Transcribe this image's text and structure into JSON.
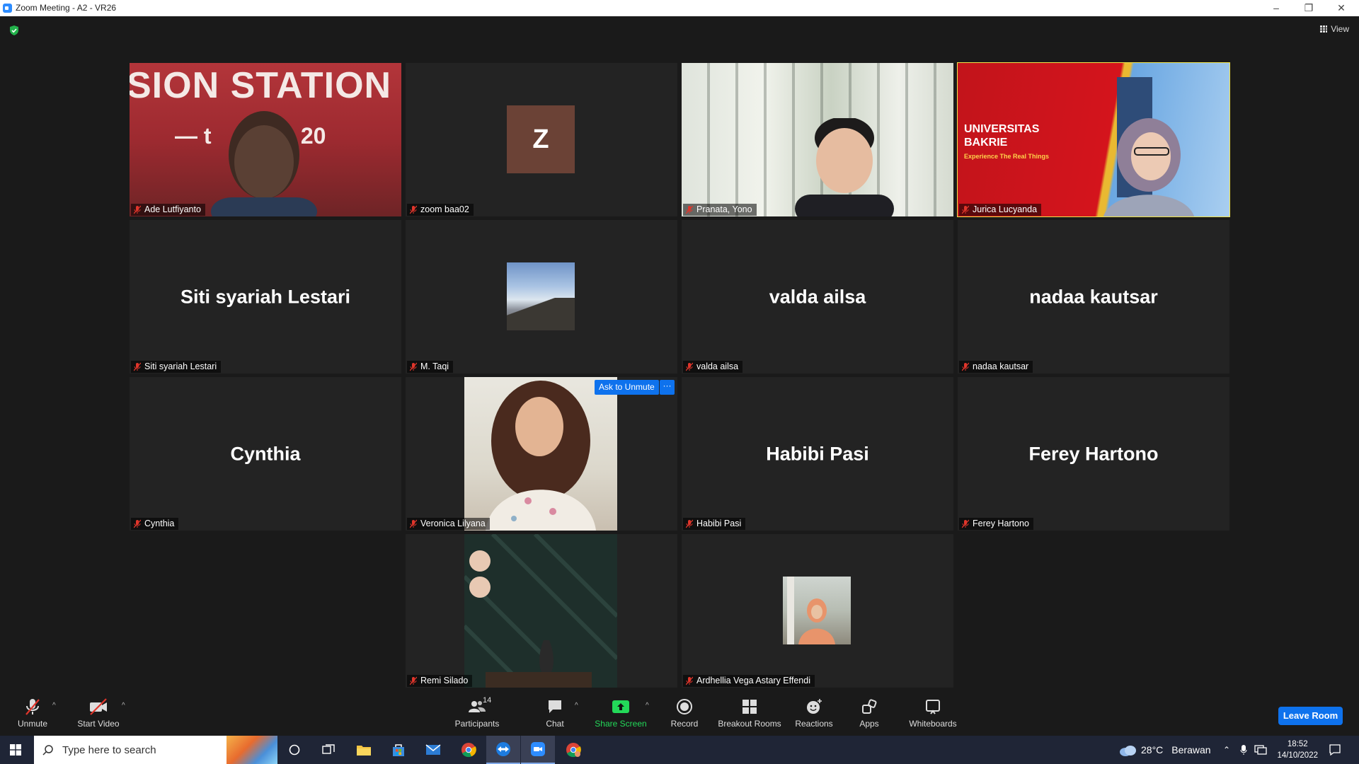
{
  "window": {
    "title": "Zoom Meeting - A2 - VR26",
    "view_label": "View"
  },
  "participants": [
    {
      "name": "Ade Lutfiyanto",
      "display": "video",
      "muted": true
    },
    {
      "name": "zoom baa02",
      "display": "avatar-letter",
      "avatar_letter": "Z",
      "avatar_color": "#6b4236",
      "muted": true
    },
    {
      "name": "Pranata, Yono",
      "display": "video",
      "muted": true
    },
    {
      "name": "Jurica Lucyanda",
      "display": "video",
      "muted": true,
      "active_speaker": true
    },
    {
      "name": "Siti syariah Lestari",
      "display": "name",
      "muted": true
    },
    {
      "name": "M. Taqi",
      "display": "photo",
      "muted": true
    },
    {
      "name": "valda ailsa",
      "display": "name",
      "muted": true
    },
    {
      "name": "nadaa kautsar",
      "display": "name",
      "muted": true
    },
    {
      "name": "Cynthia",
      "display": "name",
      "muted": true
    },
    {
      "name": "Veronica Lilyana",
      "display": "video",
      "muted": true
    },
    {
      "name": "Habibi Pasi",
      "display": "name",
      "muted": true
    },
    {
      "name": "Ferey Hartono",
      "display": "name",
      "muted": true
    },
    {
      "name": "Remi Silado",
      "display": "video",
      "muted": true
    },
    {
      "name": "Ardhellia Vega Astary Effendi",
      "display": "photo",
      "muted": true
    }
  ],
  "video_overlays": {
    "ade_banner": "SION STATION",
    "ade_banner2": "— t    since 20",
    "jurica_title": "UNIVERSITAS BAKRIE",
    "jurica_sub": "Experience The Real Things"
  },
  "hover_controls": {
    "ask_to_unmute": "Ask to Unmute",
    "more": "···"
  },
  "toolbar": {
    "unmute": "Unmute",
    "start_video": "Start Video",
    "participants": "Participants",
    "participants_count": "14",
    "chat": "Chat",
    "share_screen": "Share Screen",
    "record": "Record",
    "breakout_rooms": "Breakout Rooms",
    "reactions": "Reactions",
    "apps": "Apps",
    "whiteboards": "Whiteboards",
    "leave": "Leave Room"
  },
  "taskbar": {
    "search_placeholder": "Type here to search",
    "weather_temp": "28°C",
    "weather_desc": "Berawan",
    "time": "18:52",
    "date": "14/10/2022"
  },
  "colors": {
    "accent": "#0e72ed",
    "active_speaker": "#f2e44a",
    "muted_red": "#e0352b",
    "share_green": "#23d959"
  }
}
